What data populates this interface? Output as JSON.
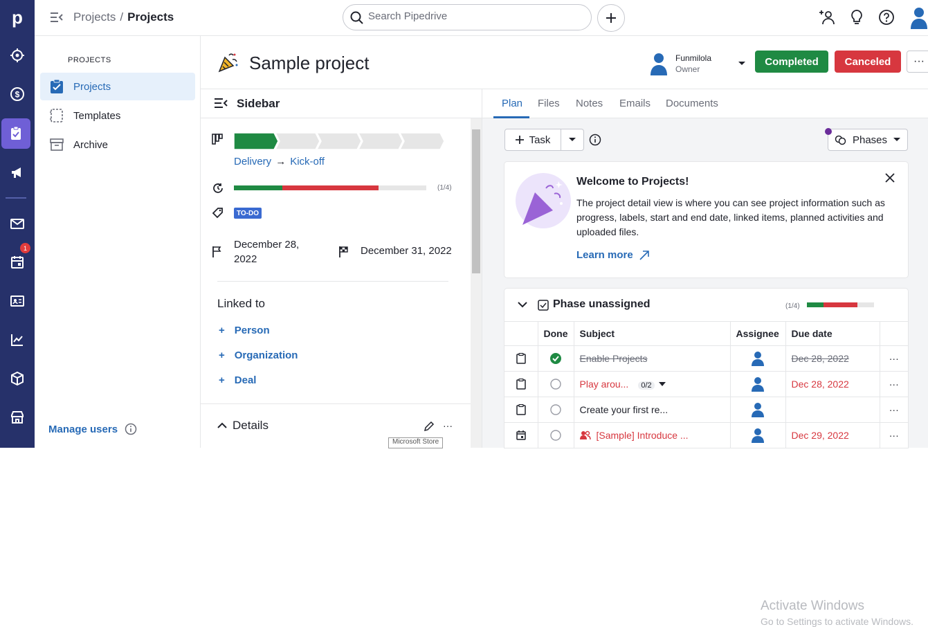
{
  "app": {
    "logo_text": "p",
    "rail": {
      "items": [
        "target-icon",
        "dollar-icon",
        "clipboard-icon",
        "megaphone-icon",
        "mail-icon",
        "calendar-icon",
        "contact-card-icon",
        "chart-icon",
        "box-icon",
        "store-icon"
      ],
      "active": "clipboard-icon",
      "calendar_badge": "1"
    },
    "brand_color": "#26316a",
    "accent_color": "#276ab6"
  },
  "topbar": {
    "breadcrumb": [
      "Projects",
      "Projects"
    ],
    "breadcrumb_separator": "/",
    "search_placeholder": "Search Pipedrive"
  },
  "projnav": {
    "heading": "PROJECTS",
    "items": [
      {
        "label": "Projects",
        "icon": "checklist-icon",
        "active": true
      },
      {
        "label": "Templates",
        "icon": "template-icon",
        "active": false
      },
      {
        "label": "Archive",
        "icon": "archive-icon",
        "active": false
      }
    ],
    "manage_users": "Manage users"
  },
  "project": {
    "title": "Sample project",
    "owner_name": "Funmilola",
    "owner_role": "Owner",
    "completed_label": "Completed",
    "canceled_label": "Canceled",
    "more_label": "···",
    "completed_color": "#1f8a43",
    "canceled_color": "#d7373f"
  },
  "sidebar": {
    "title": "Sidebar",
    "stage_from": "Delivery",
    "stage_arrow": "→",
    "stage_to": "Kick-off",
    "pipeline_stages_total": 5,
    "pipeline_stages_done": 1,
    "progress_count": "(1/4)",
    "progress_done_fraction": 0.25,
    "progress_overdue_fraction": 0.5,
    "label_tag": "TO-DO",
    "start_date": "December 28, 2022",
    "end_date": "December 31, 2022",
    "linked_title": "Linked to",
    "linked_items": [
      "Person",
      "Organization",
      "Deal"
    ],
    "details_title": "Details",
    "tooltip": "Microsoft Store"
  },
  "main": {
    "tabs": [
      "Plan",
      "Files",
      "Notes",
      "Emails",
      "Documents"
    ],
    "active_tab": "Plan",
    "task_button": "Task",
    "phases_button": "Phases",
    "welcome": {
      "title": "Welcome to Projects!",
      "body": "The project detail view is where you can see project information such as progress, labels, start and end date, linked items, planned activities and uploaded files.",
      "learn_more": "Learn more"
    },
    "phase": {
      "title": "Phase unassigned",
      "count": "(1/4)",
      "done_fraction": 0.25,
      "overdue_fraction": 0.5
    },
    "table": {
      "headers": [
        "Done",
        "Subject",
        "Assignee",
        "Due date"
      ],
      "rows": [
        {
          "icon": "clipboard-icon",
          "done": true,
          "subject": "Enable Projects",
          "subtasks": "",
          "due": "Dec 28, 2022",
          "state": "done"
        },
        {
          "icon": "clipboard-icon",
          "done": false,
          "subject": "Play arou...",
          "subtasks": "0/2",
          "due": "Dec 28, 2022",
          "state": "overdue"
        },
        {
          "icon": "clipboard-icon",
          "done": false,
          "subject": "Create your first re...",
          "subtasks": "",
          "due": "",
          "state": "normal"
        },
        {
          "icon": "calendar-icon",
          "done": false,
          "subject": "[Sample] Introduce ...",
          "subtasks": "",
          "due": "Dec 29, 2022",
          "state": "overdue"
        }
      ]
    },
    "watermark_line1": "Activate Windows",
    "watermark_line2": "Go to Settings to activate Windows."
  }
}
